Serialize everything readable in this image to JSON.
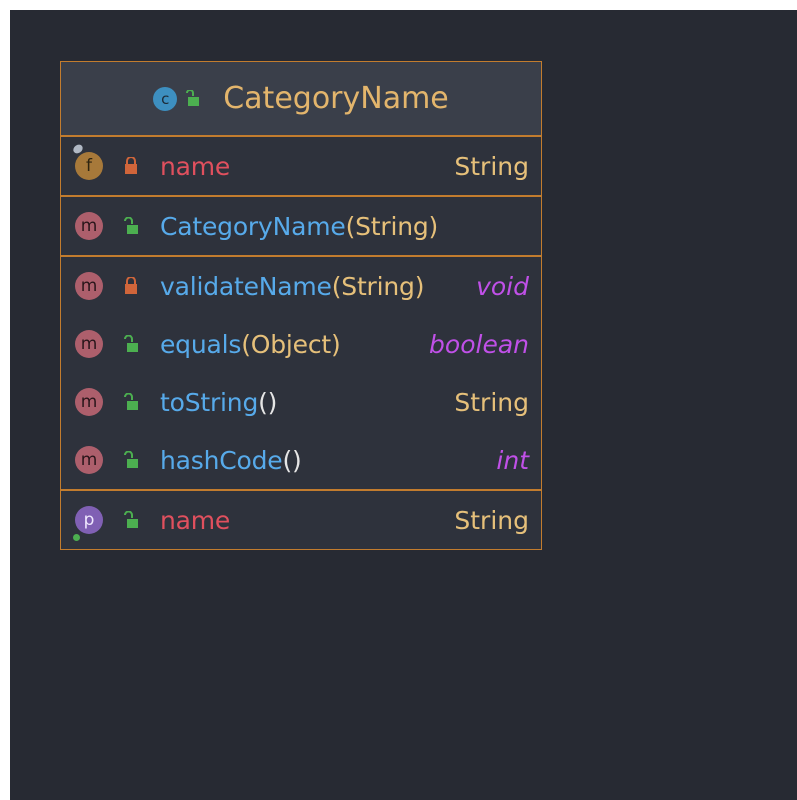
{
  "diagram": {
    "class_badge": "c",
    "class_name": "CategoryName",
    "fields": [
      {
        "badge": "f",
        "visibility": "private",
        "name": "name",
        "type": "String"
      }
    ],
    "constructors": [
      {
        "badge": "m",
        "visibility": "public",
        "name": "CategoryName",
        "params": "(String)"
      }
    ],
    "methods": [
      {
        "badge": "m",
        "visibility": "private",
        "name": "validateName",
        "params": "(String)",
        "return_type": "void"
      },
      {
        "badge": "m",
        "visibility": "public",
        "name": "equals",
        "params": "(Object)",
        "return_type": "boolean"
      },
      {
        "badge": "m",
        "visibility": "public",
        "name": "toString",
        "params": "()",
        "return_type": "String"
      },
      {
        "badge": "m",
        "visibility": "public",
        "name": "hashCode",
        "params": "()",
        "return_type": "int"
      }
    ],
    "properties": [
      {
        "badge": "p",
        "visibility": "public",
        "name": "name",
        "type": "String"
      }
    ]
  },
  "colors": {
    "background": "#272a33",
    "border": "#c27c2e",
    "private_lock": "#d0653a",
    "public_lock": "#4caf50"
  }
}
